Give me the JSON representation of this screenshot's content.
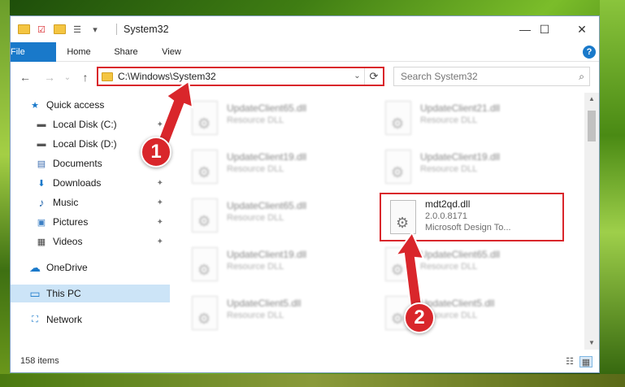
{
  "window": {
    "title": "System32",
    "controls": {
      "minimize": "—",
      "maximize": "☐",
      "close": "✕"
    }
  },
  "quick_access_toolbar": {
    "dropdown": "▾"
  },
  "ribbon": {
    "tabs": [
      "File",
      "Home",
      "Share",
      "View"
    ],
    "help": "?"
  },
  "navigation": {
    "back": "←",
    "forward": "→",
    "recent": "⌄",
    "up": "↑",
    "address": "C:\\Windows\\System32",
    "address_dropdown": "⌄",
    "refresh": "⟳",
    "search_placeholder": "Search System32",
    "search_icon": "search-icon"
  },
  "sidebar": {
    "items": [
      {
        "label": "Quick access",
        "icon": "star-icon",
        "glyph": "★",
        "color": "#1979ca",
        "pinned": false
      },
      {
        "label": "Local Disk (C:)",
        "icon": "drive-icon",
        "glyph": "▬",
        "color": "#555555",
        "pinned": true
      },
      {
        "label": "Local Disk (D:)",
        "icon": "drive-icon",
        "glyph": "▬",
        "color": "#555555",
        "pinned": true
      },
      {
        "label": "Documents",
        "icon": "documents-icon",
        "glyph": "▤",
        "color": "#3c6db0",
        "pinned": true
      },
      {
        "label": "Downloads",
        "icon": "downloads-icon",
        "glyph": "⬇",
        "color": "#1979ca",
        "pinned": true
      },
      {
        "label": "Music",
        "icon": "music-icon",
        "glyph": "♪",
        "color": "#2b6cb0",
        "pinned": true
      },
      {
        "label": "Pictures",
        "icon": "pictures-icon",
        "glyph": "▣",
        "color": "#3c7fc4",
        "pinned": true
      },
      {
        "label": "Videos",
        "icon": "videos-icon",
        "glyph": "▦",
        "color": "#444444",
        "pinned": true
      },
      {
        "label": "OneDrive",
        "icon": "onedrive-icon",
        "glyph": "☁",
        "color": "#1979ca",
        "pinned": false
      },
      {
        "label": "This PC",
        "icon": "computer-icon",
        "glyph": "▭",
        "color": "#1979ca",
        "pinned": false
      },
      {
        "label": "Network",
        "icon": "network-icon",
        "glyph": "⛶",
        "color": "#1979ca",
        "pinned": false
      }
    ],
    "pin_glyph": "✦"
  },
  "files": [
    {
      "name": "UpdateClient65.dll",
      "type": "Resource DLL"
    },
    {
      "name": "UpdateClient21.dll",
      "type": "Resource DLL"
    },
    {
      "name": "UpdateClient19.dll",
      "type": "Resource DLL"
    },
    {
      "name": "UpdateClient19.dll",
      "type": "Resource DLL"
    },
    {
      "name": "UpdateClient65.dll",
      "type": "Resource DLL"
    },
    {
      "name": "UpdateClient19.dll",
      "type": "Resource DLL"
    },
    {
      "name": "UpdateClient65.dll",
      "type": "Resource DLL"
    },
    {
      "name": "UpdateClient5.dll",
      "type": "Resource DLL"
    },
    {
      "name": "UpdateClient5.dll",
      "type": "Resource DLL"
    }
  ],
  "highlighted_file": {
    "name": "mdt2qd.dll",
    "version": "2.0.0.8171",
    "company": "Microsoft Design To..."
  },
  "status": {
    "item_count": "158 items"
  },
  "annotations": {
    "step1": "1",
    "step2": "2",
    "color": "#d9262b"
  }
}
